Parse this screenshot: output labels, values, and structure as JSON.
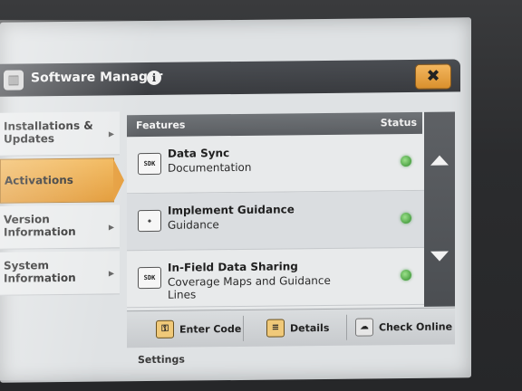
{
  "window": {
    "title": "Software Manager",
    "info_icon": "i",
    "close_icon": "✖"
  },
  "sidebar": {
    "items": [
      {
        "label": "Installations & Updates",
        "active": false
      },
      {
        "label": "Activations",
        "active": true
      },
      {
        "label": "Version Information",
        "active": false
      },
      {
        "label": "System Information",
        "active": false
      }
    ]
  },
  "table": {
    "headers": {
      "features": "Features",
      "status": "Status"
    },
    "rows": [
      {
        "name": "Data Sync",
        "sub": "Documentation",
        "icon": "SDK"
      },
      {
        "name": "Implement Guidance",
        "sub": "Guidance",
        "icon": "◈"
      },
      {
        "name": "In-Field Data Sharing",
        "sub": "Coverage Maps and Guidance Lines",
        "icon": "SDK"
      }
    ]
  },
  "toolbar": {
    "enter_code": "Enter Code",
    "details": "Details",
    "check_online": "Check Online"
  },
  "below_label": "Settings",
  "colors": {
    "accent": "#e6a041",
    "status_active": "#2e8a2a",
    "titlebar": "#393b3f"
  }
}
